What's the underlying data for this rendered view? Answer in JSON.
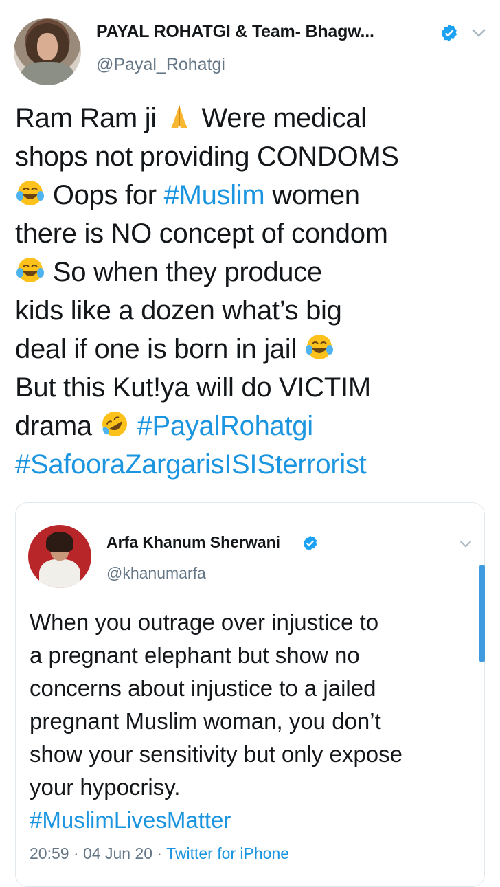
{
  "tweet": {
    "display_name": "PAYAL ROHATGI & Team- Bhagw...",
    "handle": "@Payal_Rohatgi",
    "lines": [
      {
        "pre": "Ram Ram ji ",
        "emoji": "folded-hands",
        "post": " Were medical"
      },
      {
        "pre": "shops not providing CONDOMS"
      },
      {
        "emoji_lead": "tears-of-joy",
        "pre": " Oops for ",
        "tag": "#Muslim",
        "post": " women"
      },
      {
        "pre": "there is NO concept of condom"
      },
      {
        "emoji_lead": "tears-of-joy",
        "pre": " So when they produce"
      },
      {
        "pre": "kids like a dozen what’s big"
      },
      {
        "pre": "deal if one is born in jail ",
        "emoji": "tears-of-joy"
      },
      {
        "pre": "But this Kut!ya will do VICTIM"
      },
      {
        "pre": "drama ",
        "emoji": "rolling-laughing",
        "post": " ",
        "tag": "#PayalRohatgi"
      },
      {
        "tag": "#SafooraZargarisISISterrorist"
      }
    ]
  },
  "quoted": {
    "display_name": "Arfa Khanum Sherwani",
    "handle": "@khanumarfa",
    "lines": [
      "When you outrage over injustice to",
      "a pregnant elephant but show no",
      "concerns about injustice to a jailed",
      "pregnant Muslim woman, you don’t",
      "show your sensitivity but only expose",
      "your hypocrisy."
    ],
    "hashtag": "#MuslimLivesMatter",
    "time": "20:59",
    "date": "04 Jun 20",
    "source": "Twitter for iPhone",
    "sep": " · "
  },
  "colors": {
    "link": "#1b95e0",
    "muted": "#657786",
    "verified": "#1da1f2"
  }
}
